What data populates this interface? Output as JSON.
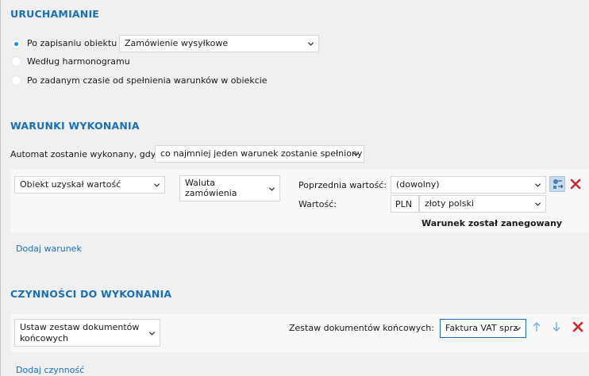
{
  "sections": {
    "trigger": {
      "title": "URUCHAMIANIE",
      "options": [
        "Po zapisaniu obiektu",
        "Według harmonogramu",
        "Po zadanym czasie od spełnienia warunków w obiekcie"
      ],
      "selected_option": 0,
      "object_select": "Zamówienie wysyłkowe"
    },
    "conditions": {
      "title": "WARUNKI WYKONANIA",
      "intro_label": "Automat zostanie wykonany, gdy",
      "mode_select": "co najmniej jeden warunek zostanie spełniony",
      "row": {
        "condition_select": "Obiekt uzyskał wartość",
        "field_select_line1": "Waluta",
        "field_select_line2": "zamówienia",
        "previous_label": "Poprzednia wartość:",
        "previous_value": "(dowolny)",
        "value_label": "Wartość:",
        "currency_code": "PLN",
        "currency_name": "złoty polski",
        "negated_text": "Warunek został zanegowany"
      },
      "add_link": "Dodaj warunek"
    },
    "actions": {
      "title": "CZYNNOŚCI DO WYKONANIA",
      "row": {
        "action_select_line1": "Ustaw zestaw dokumentów",
        "action_select_line2": "końcowych",
        "set_label": "Zestaw dokumentów końcowych:",
        "set_value": "Faktura VAT sprz"
      },
      "add_link": "Dodaj czynność"
    }
  },
  "colors": {
    "accent": "#1b6fb5",
    "delete": "#d9262c",
    "radio_selected": "#1e90e0",
    "arrow": "#6aaee0"
  },
  "icons": {
    "negate": "negate-condition-icon",
    "delete": "close-x-icon",
    "up": "arrow-up-icon",
    "down": "arrow-down-icon"
  }
}
